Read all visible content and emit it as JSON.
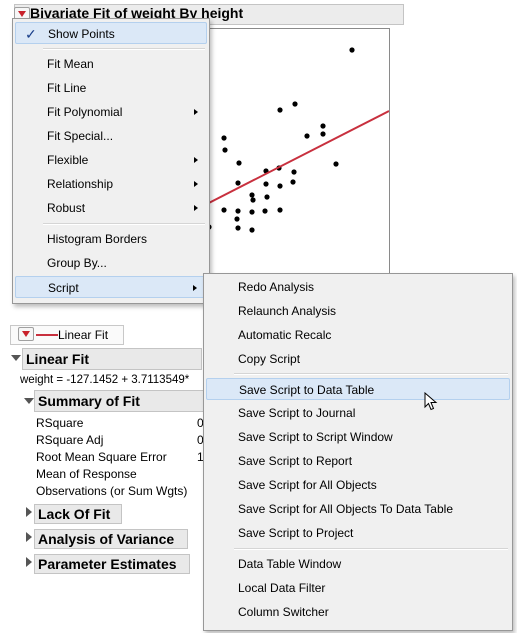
{
  "header": {
    "title": "Bivariate Fit of weight By height"
  },
  "main_menu": {
    "items": [
      {
        "label": "Show Points",
        "checked": true
      },
      {
        "label": "Fit Mean"
      },
      {
        "label": "Fit Line"
      },
      {
        "label": "Fit Polynomial",
        "submenu": true
      },
      {
        "label": "Fit Special..."
      },
      {
        "label": "Flexible",
        "submenu": true
      },
      {
        "label": "Relationship",
        "submenu": true
      },
      {
        "label": "Robust",
        "submenu": true
      },
      {
        "label": "Histogram Borders"
      },
      {
        "label": "Group By..."
      },
      {
        "label": "Script",
        "submenu": true,
        "highlighted": true
      }
    ]
  },
  "script_menu": {
    "items": [
      {
        "label": "Redo Analysis",
        "submenu": true
      },
      {
        "label": "Relaunch Analysis"
      },
      {
        "label": "Automatic Recalc"
      },
      {
        "label": "Copy Script"
      },
      {
        "label": "Save Script to Data Table",
        "highlighted": true
      },
      {
        "label": "Save Script to Journal"
      },
      {
        "label": "Save Script to Script Window"
      },
      {
        "label": "Save Script to Report"
      },
      {
        "label": "Save Script for All Objects"
      },
      {
        "label": "Save Script for All Objects To Data Table"
      },
      {
        "label": "Save Script to Project"
      },
      {
        "label": "Data Table Window"
      },
      {
        "label": "Local Data Filter"
      },
      {
        "label": "Column Switcher"
      }
    ]
  },
  "legend": {
    "label": "Linear Fit",
    "line_color": "#c8303e"
  },
  "linear_fit": {
    "title": "Linear Fit",
    "equation": "weight = -127.1452 + 3.7113549*",
    "summary": {
      "title": "Summary of Fit",
      "rows": [
        {
          "label": "RSquare",
          "value": "0"
        },
        {
          "label": "RSquare Adj",
          "value": "0"
        },
        {
          "label": "Root Mean Square Error",
          "value": "1"
        },
        {
          "label": "Mean of Response",
          "value": ""
        },
        {
          "label": "Observations (or Sum Wgts)",
          "value": ""
        }
      ]
    },
    "lack_of_fit": "Lack Of Fit",
    "anova": "Analysis of Variance",
    "parameters": "Parameter Estimates"
  },
  "colors": {
    "fit_line": "#c8303e",
    "menu_highlight": "#dbe8f7",
    "point": "#000000"
  }
}
